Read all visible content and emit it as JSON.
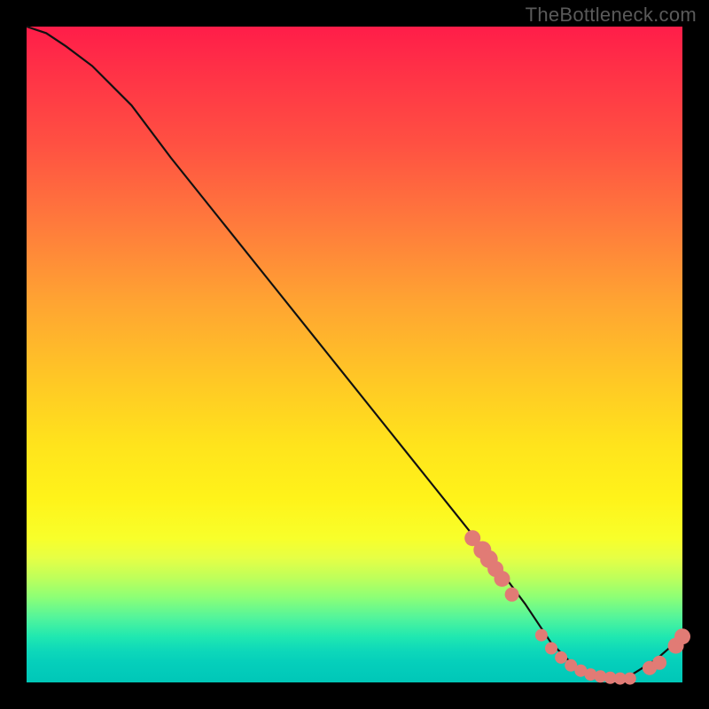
{
  "watermark": "TheBottleneck.com",
  "colors": {
    "dot": "#e17b75",
    "line": "#111",
    "panel_bg_top": "#ff1d49",
    "panel_bg_bottom": "#00c7b8",
    "page_bg": "#000000"
  },
  "chart_data": {
    "type": "line",
    "title": "",
    "xlabel": "",
    "ylabel": "",
    "xlim": [
      0,
      100
    ],
    "ylim": [
      0,
      100
    ],
    "x": [
      0,
      3,
      6,
      10,
      16,
      22,
      30,
      38,
      46,
      54,
      62,
      70,
      76,
      80,
      84,
      88,
      92,
      96,
      100
    ],
    "values": [
      100,
      99,
      97,
      94,
      88,
      80,
      70,
      60,
      50,
      40,
      30,
      20,
      12,
      6,
      2,
      0.5,
      1,
      3.5,
      7
    ],
    "flat_zone_x": [
      80,
      92
    ],
    "scatter_red": {
      "x": [
        68,
        69.5,
        70.5,
        71.5,
        72.5,
        74,
        78.5,
        80,
        81.5,
        83,
        84.5,
        86,
        87.5,
        89,
        90.5,
        92,
        95,
        96.5,
        99,
        100
      ],
      "y": [
        22,
        20.2,
        18.8,
        17.3,
        15.8,
        13.4,
        7.2,
        5.2,
        3.8,
        2.6,
        1.8,
        1.2,
        0.9,
        0.7,
        0.6,
        0.6,
        2.2,
        3.0,
        5.6,
        7.0
      ],
      "r": [
        9,
        10,
        10,
        9,
        9,
        8,
        7,
        7,
        7,
        7,
        7,
        7,
        7,
        7,
        7,
        7,
        8,
        8,
        9,
        9
      ]
    }
  }
}
